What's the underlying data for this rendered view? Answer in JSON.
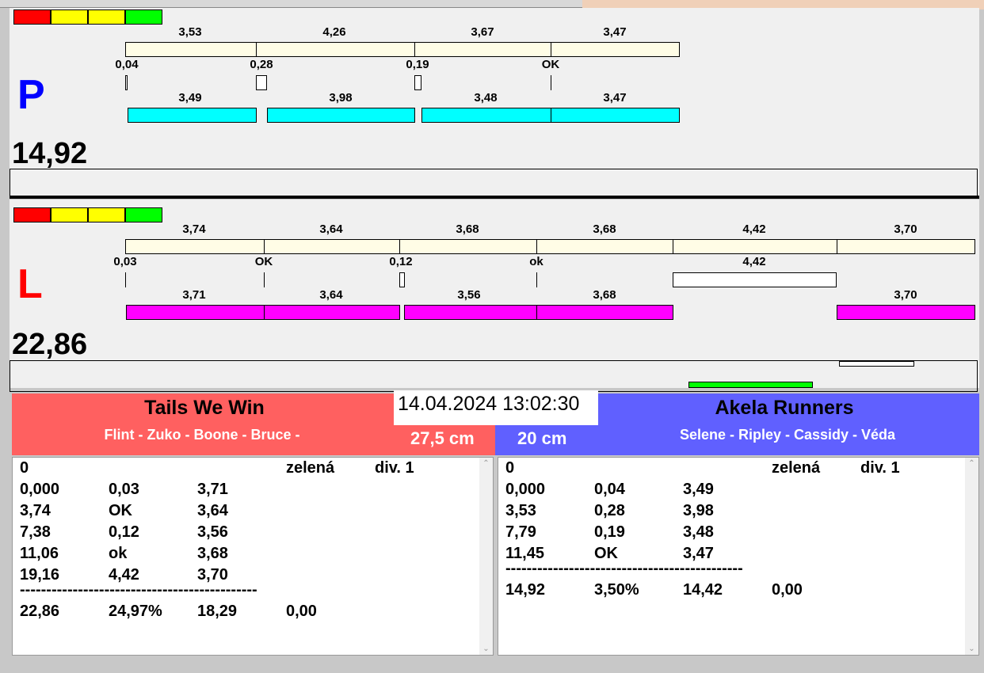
{
  "legend_colors": [
    "#ff0000",
    "#ffff00",
    "#ffff00",
    "#00ff00"
  ],
  "p": {
    "letter": "P",
    "total": "14,92",
    "top_labels": [
      "3,53",
      "4,26",
      "3,67",
      "3,47"
    ],
    "mid_labels": [
      "0,04",
      "0,28",
      "0,19",
      "OK"
    ],
    "bottom_labels": [
      "3,49",
      "3,98",
      "3,48",
      "3,47"
    ]
  },
  "l": {
    "letter": "L",
    "total": "22,86",
    "top_labels": [
      "3,74",
      "3,64",
      "3,68",
      "3,68",
      "4,42",
      "3,70"
    ],
    "mid_labels": [
      "0,03",
      "OK",
      "0,12",
      "ok",
      "4,42"
    ],
    "bottom_labels": [
      "3,71",
      "3,64",
      "3,56",
      "3,68",
      "3,70"
    ]
  },
  "datetime": "14.04.2024 13:02:30",
  "left_team": {
    "name": "Tails We Win",
    "members": "Flint - Zuko - Boone - Bruce -",
    "height": "27,5 cm",
    "color": "#ff6060",
    "rows": [
      [
        "0",
        "",
        "",
        "zelená",
        "div. 1"
      ],
      [
        "0,000",
        "0,03",
        "3,71"
      ],
      [
        "3,74",
        "OK",
        "3,64"
      ],
      [
        "7,38",
        "0,12",
        "3,56"
      ],
      [
        "11,06",
        "ok",
        "3,68"
      ],
      [
        "19,16",
        "4,42",
        "3,70"
      ]
    ],
    "separator": "---------------------------------------------",
    "summary": [
      "22,86",
      "24,97%",
      "18,29",
      "0,00"
    ]
  },
  "right_team": {
    "name": "Akela Runners",
    "members": "Selene - Ripley - Cassidy - Véda",
    "height": "20 cm",
    "color": "#6060ff",
    "rows": [
      [
        "0",
        "",
        "",
        "zelená",
        "div. 1"
      ],
      [
        "0,000",
        "0,04",
        "3,49"
      ],
      [
        "3,53",
        "0,28",
        "3,98"
      ],
      [
        "7,79",
        "0,19",
        "3,48"
      ],
      [
        "11,45",
        "OK",
        "3,47"
      ]
    ],
    "separator": "---------------------------------------------",
    "summary": [
      "14,92",
      "3,50%",
      "14,42",
      "0,00"
    ]
  }
}
